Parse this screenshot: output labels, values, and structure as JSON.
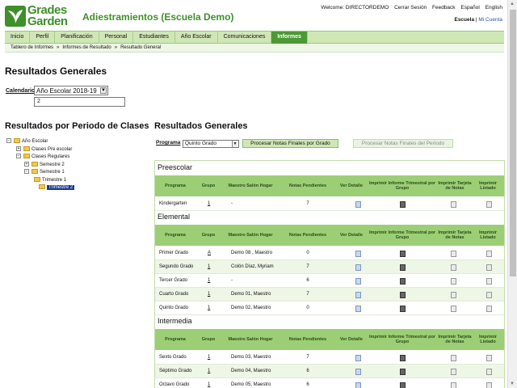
{
  "app": {
    "logo_line1": "Grades",
    "logo_line2": "Garden",
    "title": "Adiestramientos (Escuela Demo)"
  },
  "topnav": {
    "welcome": "Welcome: DIRECTORDEMO",
    "logout": "Cerrar Sesión",
    "feedback": "Feedback",
    "espanol": "Español",
    "english": "English"
  },
  "subnav": {
    "school": "Escuela",
    "account": "Mi Cuenta"
  },
  "tabs": [
    "Inicio",
    "Perfil",
    "Planificación",
    "Personal",
    "Estudiantes",
    "Año Escolar",
    "Comunicaciones",
    "Informes"
  ],
  "active_tab": "Informes",
  "breadcrumbs": [
    "Tablero de Informes",
    "Informes de Resultado",
    "Resultado General"
  ],
  "page": {
    "title": "Resultados Generales",
    "calendar_label": "Calendario",
    "calendar_value": "Año Escolar 2018-19",
    "input_value": "2",
    "left_heading": "Resultados por Periodo de Clases",
    "right_heading": "Resultados Generales"
  },
  "tree": [
    {
      "label": "Año Escolar",
      "pm": "−"
    },
    {
      "label": "Clases Pre escolar",
      "pm": "+"
    },
    {
      "label": "Clases Regulares",
      "pm": "−"
    },
    {
      "label": "Semestre 2",
      "pm": "+"
    },
    {
      "label": "Semestre 1",
      "pm": "−"
    },
    {
      "label": "Trimestre 1",
      "pm": ""
    },
    {
      "label": "Trimestre 2",
      "pm": "",
      "selected": true
    }
  ],
  "program": {
    "label": "Programa",
    "value": "Quinto Grado",
    "process_button": "Procesar Notas Finales por Grado",
    "process_period_button": "Procesar Notas Finales del Periodo"
  },
  "columns": [
    "Programa",
    "Grupo",
    "Maestro Salón Hogar",
    "Notas Pendientes",
    "Ver Detalle",
    "Imprimir Informe Trimestral por Grupo",
    "Imprimir Tarjeta de Notas",
    "Imprimir Listado"
  ],
  "sections": [
    {
      "title": "Preescolar",
      "rows": [
        {
          "programa": "Kindergarten",
          "grupo": "1",
          "maestro": "-",
          "pendientes": "7"
        }
      ]
    },
    {
      "title": "Elemental",
      "rows": [
        {
          "programa": "Primer Grado",
          "grupo": "A",
          "maestro": "Demo 08 , Maestro",
          "pendientes": "0"
        },
        {
          "programa": "Segundo Grado",
          "grupo": "1",
          "maestro": "Colón Díaz, Myriam",
          "pendientes": "7"
        },
        {
          "programa": "Tercer Grado",
          "grupo": "1",
          "maestro": "-",
          "pendientes": "6"
        },
        {
          "programa": "Cuarto Grado",
          "grupo": "1",
          "maestro": "Demo 01, Maestro",
          "pendientes": "7"
        },
        {
          "programa": "Quinto Grado",
          "grupo": "1",
          "maestro": "Demo 02, Maestro",
          "pendientes": "0"
        }
      ]
    },
    {
      "title": "Intermedia",
      "rows": [
        {
          "programa": "Sexto Grado",
          "grupo": "1",
          "maestro": "Demo 03, Maestro",
          "pendientes": "7"
        },
        {
          "programa": "Séptimo Grado",
          "grupo": "1",
          "maestro": "Demo 04, Maestro",
          "pendientes": "6"
        },
        {
          "programa": "Octavo Grado",
          "grupo": "1",
          "maestro": "Demo 05, Maestro",
          "pendientes": "6"
        }
      ]
    }
  ],
  "colors": {
    "brand_green": "#3f8f2a",
    "tab_bg": "#cfe7b5",
    "tab_active": "#4b9a34",
    "table_header": "#9ccf75",
    "row_alt": "#eef6e6"
  }
}
